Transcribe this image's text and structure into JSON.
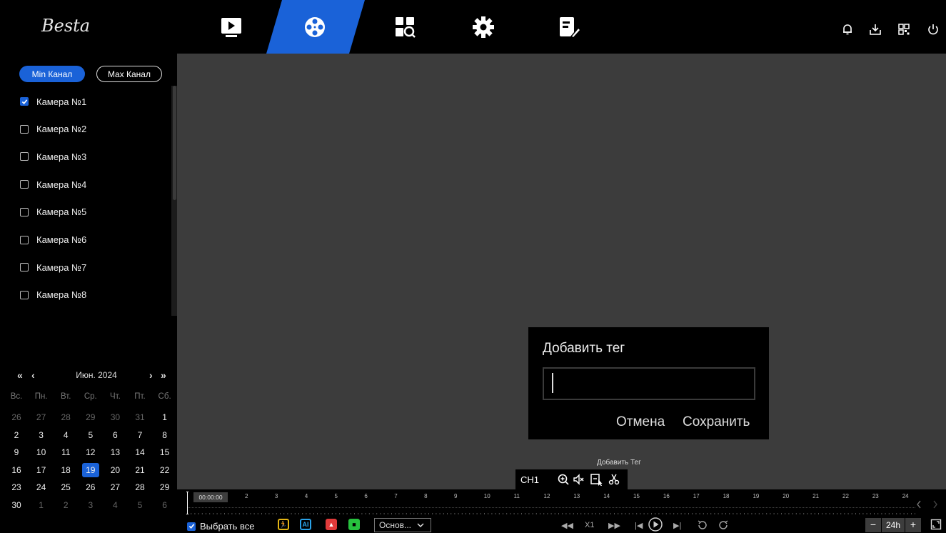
{
  "app": {
    "logo": "Besta"
  },
  "nav": {
    "tabs": [
      {
        "icon": "playback-tv-icon"
      },
      {
        "icon": "film-reel-icon",
        "active": true
      },
      {
        "icon": "search-grid-icon"
      },
      {
        "icon": "gear-icon"
      },
      {
        "icon": "maintenance-icon"
      }
    ],
    "active_color": "#1a62d8"
  },
  "top_icons": [
    "bell-icon",
    "download-icon",
    "layout-grid-icon",
    "power-icon"
  ],
  "sidebar": {
    "min_channel": "Min Канал",
    "max_channel": "Max Канал",
    "cameras": [
      {
        "label": "Камера №1",
        "checked": true
      },
      {
        "label": "Камера №2",
        "checked": false
      },
      {
        "label": "Камера №3",
        "checked": false
      },
      {
        "label": "Камера №4",
        "checked": false
      },
      {
        "label": "Камера №5",
        "checked": false
      },
      {
        "label": "Камера №6",
        "checked": false
      },
      {
        "label": "Камера №7",
        "checked": false
      },
      {
        "label": "Камера №8",
        "checked": false
      }
    ]
  },
  "calendar": {
    "month": "Июн. 2024",
    "prev_year": "«",
    "prev_month": "‹",
    "next_month": "›",
    "next_year": "»",
    "weekdays": [
      "Вс.",
      "Пн.",
      "Вт.",
      "Ср.",
      "Чт.",
      "Пт.",
      "Сб."
    ],
    "weeks": [
      [
        "26",
        "27",
        "28",
        "29",
        "30",
        "31",
        "1"
      ],
      [
        "2",
        "3",
        "4",
        "5",
        "6",
        "7",
        "8"
      ],
      [
        "9",
        "10",
        "11",
        "12",
        "13",
        "14",
        "15"
      ],
      [
        "16",
        "17",
        "18",
        "19",
        "20",
        "21",
        "22"
      ],
      [
        "23",
        "24",
        "25",
        "26",
        "27",
        "28",
        "29"
      ],
      [
        "30",
        "1",
        "2",
        "3",
        "4",
        "5",
        "6"
      ]
    ],
    "selected": "19"
  },
  "dialog": {
    "title": "Добавить тег",
    "input_value": "",
    "cancel": "Отмена",
    "save": "Сохранить"
  },
  "toolbar": {
    "tooltip": "Добавить Тег",
    "channel": "CH1"
  },
  "timeline": {
    "start_time": "00:00:00",
    "hours": [
      "2",
      "3",
      "4",
      "5",
      "6",
      "7",
      "8",
      "9",
      "10",
      "11",
      "12",
      "13",
      "14",
      "15",
      "16",
      "17",
      "18",
      "19",
      "20",
      "21",
      "22",
      "23",
      "24"
    ]
  },
  "bottom": {
    "select_all": "Выбрать все",
    "stream": "Основ...",
    "speed": "X1",
    "zoom": "24h",
    "zoom_minus": "−",
    "zoom_plus": "+"
  }
}
